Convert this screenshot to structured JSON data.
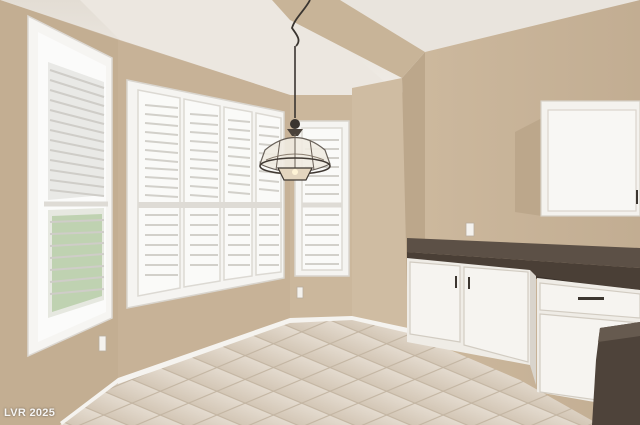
{
  "watermark": "LVR 2025",
  "colors": {
    "wall": "#c9b59a",
    "wall_shadow": "#b5a084",
    "ceiling": "#ebe6df",
    "trim": "#f4f2ee",
    "tile": "#ddd2c3",
    "grout": "#c4b6a3",
    "countertop": "#5a4e44",
    "cabinet": "#f3f1ec"
  },
  "fixtures": {
    "chandelier": "chandelier-icon",
    "window": "plantation-shutter-window",
    "outlet": "outlet-icon"
  }
}
